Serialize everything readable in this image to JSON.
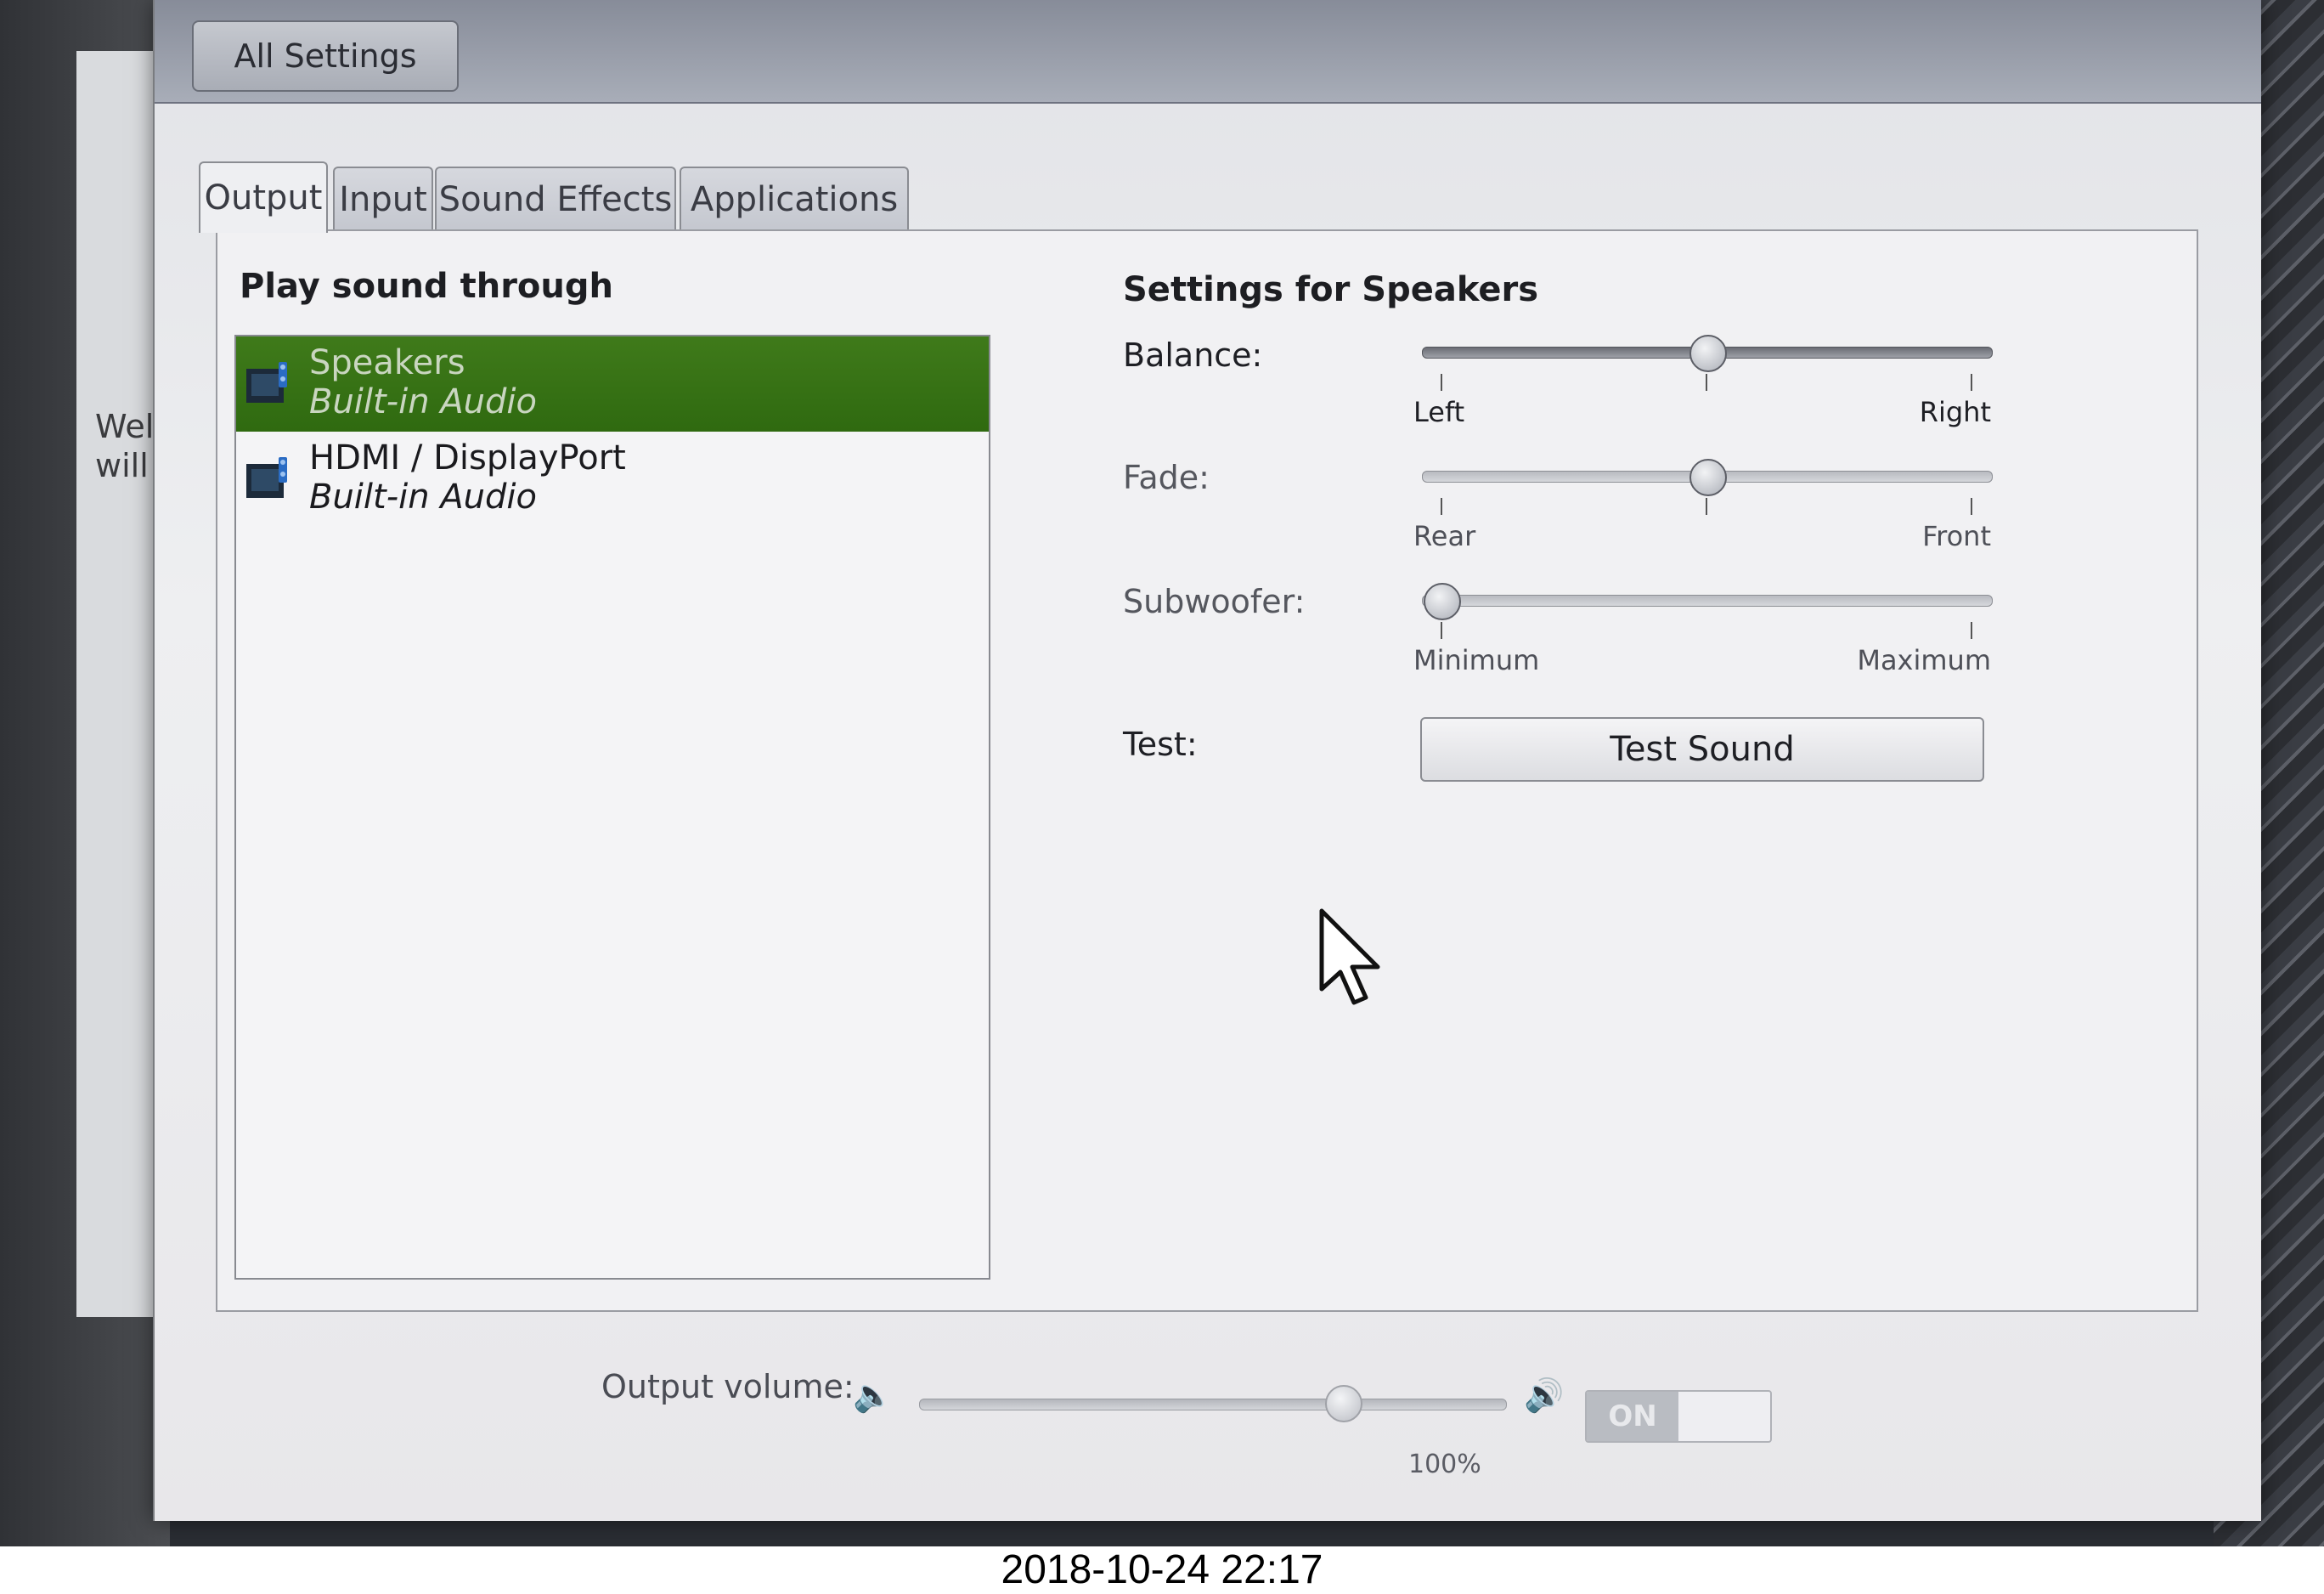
{
  "background_window": {
    "lines": [
      "Wel",
      "will"
    ]
  },
  "header": {
    "all_settings_label": "All Settings"
  },
  "tabs": [
    {
      "label": "Output",
      "active": true
    },
    {
      "label": "Input",
      "active": false
    },
    {
      "label": "Sound Effects",
      "active": false
    },
    {
      "label": "Applications",
      "active": false
    }
  ],
  "output": {
    "play_through_title": "Play sound through",
    "devices": [
      {
        "name": "Speakers",
        "description": "Built-in Audio",
        "selected": true,
        "icon": "audio-card-icon"
      },
      {
        "name": "HDMI / DisplayPort",
        "description": "Built-in Audio",
        "selected": false,
        "icon": "audio-card-icon"
      }
    ],
    "settings_title": "Settings for Speakers",
    "balance": {
      "label": "Balance:",
      "min_label": "Left",
      "max_label": "Right",
      "value": 0.5
    },
    "fade": {
      "label": "Fade:",
      "min_label": "Rear",
      "max_label": "Front",
      "value": 0.5
    },
    "subwoofer": {
      "label": "Subwoofer:",
      "min_label": "Minimum",
      "max_label": "Maximum",
      "value": 0.0
    },
    "test_label": "Test:",
    "test_button_label": "Test Sound"
  },
  "volume": {
    "label": "Output volume:",
    "percent_label": "100%",
    "level": 0.72,
    "switch_label": "ON",
    "low_icon": "speaker-low-icon",
    "high_icon": "speaker-high-icon"
  },
  "photo_timestamp": "2018-10-24 22:17",
  "colors": {
    "selection": "#3f7a1a",
    "header_bar": "#9aa0ad"
  }
}
